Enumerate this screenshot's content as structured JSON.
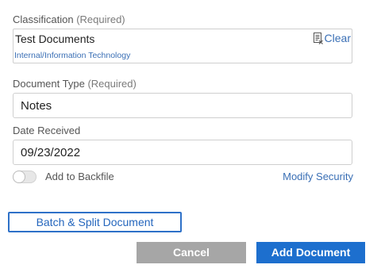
{
  "classification": {
    "label": "Classification",
    "required_suffix": "(Required)",
    "value": "Test Documents",
    "path": "Internal/Information Technology",
    "clear_label": "Clear",
    "clear_icon": "clear-document-icon"
  },
  "document_type": {
    "label": "Document Type",
    "required_suffix": "(Required)",
    "value": "Notes"
  },
  "date_received": {
    "label": "Date Received",
    "value": "09/23/2022"
  },
  "backfile": {
    "label": "Add to Backfile",
    "checked": false
  },
  "modify_security_label": "Modify Security",
  "buttons": {
    "batch_split": "Batch & Split Document",
    "cancel": "Cancel",
    "add_document": "Add Document"
  },
  "colors": {
    "link": "#3a6fb5",
    "primary": "#1d6fce",
    "secondary": "#a6a6a6"
  }
}
